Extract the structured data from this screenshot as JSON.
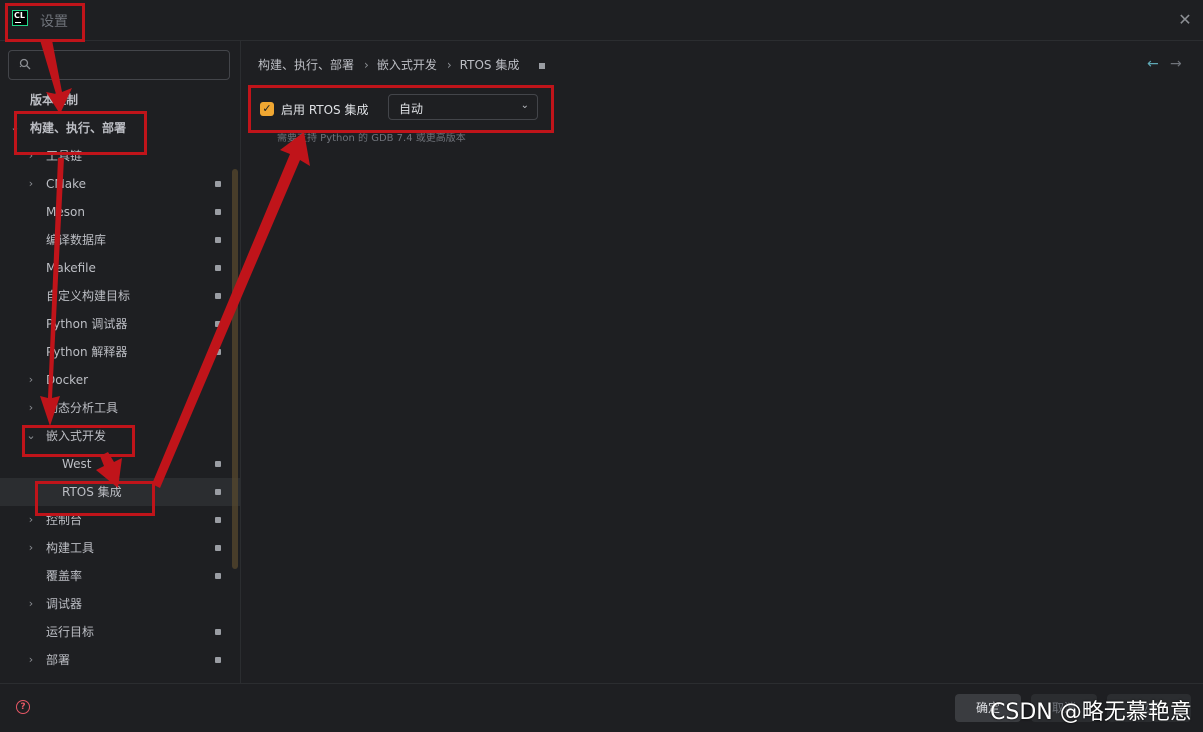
{
  "window": {
    "title": "设置",
    "logo_text": "CL"
  },
  "search": {
    "value": "",
    "placeholder": ""
  },
  "tree": [
    {
      "label": "版本控制",
      "depth": 0,
      "chevron": "",
      "badge": false,
      "section": true
    },
    {
      "label": "构建、执行、部署",
      "depth": 0,
      "chevron": "expanded",
      "badge": false,
      "section": true
    },
    {
      "label": "工具链",
      "depth": 1,
      "chevron": "collapsed",
      "badge": false
    },
    {
      "label": "CMake",
      "depth": 1,
      "chevron": "collapsed",
      "badge": true
    },
    {
      "label": "Meson",
      "depth": 1,
      "chevron": "",
      "badge": true
    },
    {
      "label": "编译数据库",
      "depth": 1,
      "chevron": "",
      "badge": true
    },
    {
      "label": "Makefile",
      "depth": 1,
      "chevron": "",
      "badge": true
    },
    {
      "label": "自定义构建目标",
      "depth": 1,
      "chevron": "",
      "badge": true
    },
    {
      "label": "Python 调试器",
      "depth": 1,
      "chevron": "",
      "badge": true
    },
    {
      "label": "Python 解释器",
      "depth": 1,
      "chevron": "",
      "badge": true
    },
    {
      "label": "Docker",
      "depth": 1,
      "chevron": "collapsed",
      "badge": false
    },
    {
      "label": "动态分析工具",
      "depth": 1,
      "chevron": "collapsed",
      "badge": false
    },
    {
      "label": "嵌入式开发",
      "depth": 1,
      "chevron": "expanded",
      "badge": false
    },
    {
      "label": "West",
      "depth": 2,
      "chevron": "",
      "badge": true
    },
    {
      "label": "RTOS 集成",
      "depth": 2,
      "chevron": "",
      "badge": true,
      "selected": true
    },
    {
      "label": "控制台",
      "depth": 1,
      "chevron": "collapsed",
      "badge": true
    },
    {
      "label": "构建工具",
      "depth": 1,
      "chevron": "collapsed",
      "badge": true
    },
    {
      "label": "覆盖率",
      "depth": 1,
      "chevron": "",
      "badge": true
    },
    {
      "label": "调试器",
      "depth": 1,
      "chevron": "collapsed",
      "badge": false
    },
    {
      "label": "运行目标",
      "depth": 1,
      "chevron": "",
      "badge": true
    },
    {
      "label": "部署",
      "depth": 1,
      "chevron": "collapsed",
      "badge": true
    }
  ],
  "breadcrumb": {
    "items": [
      "构建、执行、部署",
      "嵌入式开发",
      "RTOS 集成"
    ],
    "separator": "›"
  },
  "nav": {
    "back": "←",
    "forward": "→"
  },
  "rtos": {
    "enabled": true,
    "checkbox_label": "启用 RTOS 集成",
    "mode_value": "自动",
    "hint": "需要支持 Python 的 GDB 7.4 或更高版本"
  },
  "buttons": {
    "ok": "确定",
    "cancel": "取消",
    "apply": "应用"
  },
  "watermark": "CSDN @略无慕艳意",
  "colors": {
    "background": "#1e1f22",
    "accent_checkbox": "#f0a732",
    "annotation_red": "#c0141a"
  }
}
